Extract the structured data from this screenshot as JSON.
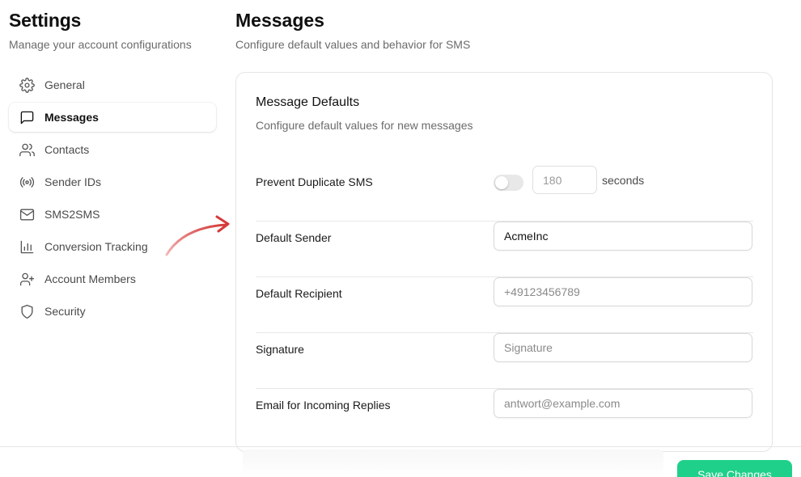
{
  "sidebar": {
    "title": "Settings",
    "subtitle": "Manage your account configurations",
    "items": [
      {
        "label": "General",
        "icon": "gear-icon"
      },
      {
        "label": "Messages",
        "icon": "message-square-icon",
        "active": true
      },
      {
        "label": "Contacts",
        "icon": "users-icon"
      },
      {
        "label": "Sender IDs",
        "icon": "radio-broadcast-icon"
      },
      {
        "label": "SMS2SMS",
        "icon": "mail-icon"
      },
      {
        "label": "Conversion Tracking",
        "icon": "bar-chart-icon"
      },
      {
        "label": "Account Members",
        "icon": "user-plus-icon"
      },
      {
        "label": "Security",
        "icon": "shield-icon"
      }
    ]
  },
  "main": {
    "title": "Messages",
    "subtitle": "Configure default values and behavior for SMS"
  },
  "card": {
    "title": "Message Defaults",
    "subtitle": "Configure default values for new messages",
    "duplicate": {
      "label": "Prevent Duplicate SMS",
      "enabled": false,
      "placeholder": "180",
      "unit": "seconds"
    },
    "sender": {
      "label": "Default Sender",
      "value": "AcmeInc"
    },
    "recipient": {
      "label": "Default Recipient",
      "placeholder": "+49123456789"
    },
    "signature": {
      "label": "Signature",
      "placeholder": "Signature"
    },
    "email": {
      "label": "Email for Incoming Replies",
      "placeholder": "antwort@example.com"
    }
  },
  "footer": {
    "save_label": "Save Changes"
  },
  "colors": {
    "accent": "#1fd08a",
    "arrow": "#d63a3a"
  }
}
